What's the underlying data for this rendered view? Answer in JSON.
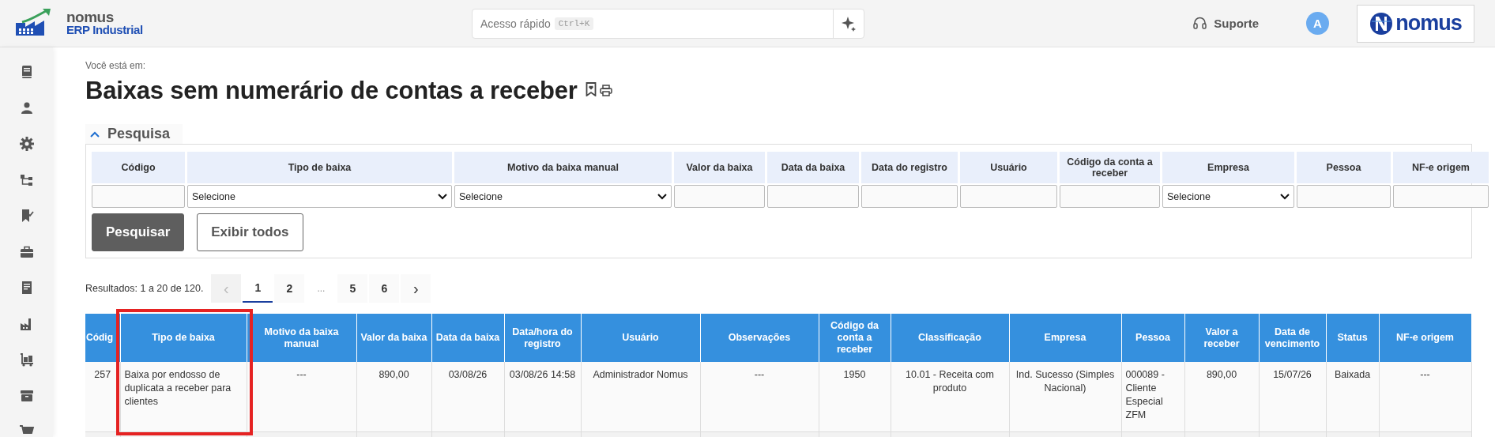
{
  "header": {
    "logo": {
      "name": "nomus",
      "subtitle": "ERP Industrial"
    },
    "quick_access": {
      "placeholder": "Acesso rápido",
      "shortcut": "Ctrl+K"
    },
    "support": "Suporte",
    "avatar": "A",
    "brand": "nomus"
  },
  "breadcrumb_label": "Você está em:",
  "title": "Baixas sem numerário de contas a receber",
  "search_panel": {
    "title": "Pesquisa",
    "expanded": true,
    "fields": [
      {
        "label": "Código",
        "kind": "text"
      },
      {
        "label": "Tipo de baixa",
        "kind": "select",
        "value": "Selecione"
      },
      {
        "label": "Motivo da baixa manual",
        "kind": "select",
        "value": "Selecione"
      },
      {
        "label": "Valor da baixa",
        "kind": "text"
      },
      {
        "label": "Data da baixa",
        "kind": "text"
      },
      {
        "label": "Data do registro",
        "kind": "text"
      },
      {
        "label": "Usuário",
        "kind": "text"
      },
      {
        "label": "Código da conta a receber",
        "kind": "text"
      },
      {
        "label": "Empresa",
        "kind": "select",
        "value": "Selecione"
      },
      {
        "label": "Pessoa",
        "kind": "text"
      },
      {
        "label": "NF-e origem",
        "kind": "text"
      }
    ],
    "buttons": [
      {
        "label": "Pesquisar",
        "kind": "primary"
      },
      {
        "label": "Exibir todos",
        "kind": "secondary"
      }
    ]
  },
  "results": {
    "summary": "Resultados: 1 a 20 de 120.",
    "pagination": [
      {
        "label": "‹",
        "kind": "prev",
        "selected": false,
        "disabled": true
      },
      {
        "label": "1",
        "kind": "page",
        "selected": true
      },
      {
        "label": "2",
        "kind": "page",
        "selected": false
      },
      {
        "label": "...",
        "kind": "ellipsis",
        "selected": false
      },
      {
        "label": "5",
        "kind": "page",
        "selected": false
      },
      {
        "label": "6",
        "kind": "page",
        "selected": false
      },
      {
        "label": "›",
        "kind": "next",
        "selected": false,
        "disabled": false
      }
    ]
  },
  "table": {
    "columns": [
      {
        "label": "Códig",
        "highlighted": false
      },
      {
        "label": "Tipo de baixa",
        "highlighted": true
      },
      {
        "label": "Motivo da baixa manual",
        "highlighted": false
      },
      {
        "label": "Valor da baixa",
        "highlighted": false
      },
      {
        "label": "Data da baixa",
        "highlighted": false
      },
      {
        "label": "Data/hora do registro",
        "highlighted": false
      },
      {
        "label": "Usuário",
        "highlighted": false
      },
      {
        "label": "Observações",
        "highlighted": false
      },
      {
        "label": "Código da conta a receber",
        "highlighted": false
      },
      {
        "label": "Classificação",
        "highlighted": false
      },
      {
        "label": "Empresa",
        "highlighted": false
      },
      {
        "label": "Pessoa",
        "highlighted": false
      },
      {
        "label": "Valor a receber",
        "highlighted": false
      },
      {
        "label": "Data de vencimento",
        "highlighted": false
      },
      {
        "label": "Status",
        "highlighted": false
      },
      {
        "label": "NF-e origem",
        "highlighted": false
      }
    ],
    "rows": [
      {
        "cells": [
          "257",
          "Baixa por endosso de duplicata a receber para clientes",
          "---",
          "890,00",
          "03/08/26",
          "03/08/26 14:58",
          "Administrador Nomus",
          "---",
          "1950",
          "10.01 - Receita com produto",
          "Ind. Sucesso (Simples Nacional)",
          "000089 - Cliente Especial ZFM",
          "890,00",
          "15/07/26",
          "Baixada",
          "---"
        ]
      }
    ]
  }
}
